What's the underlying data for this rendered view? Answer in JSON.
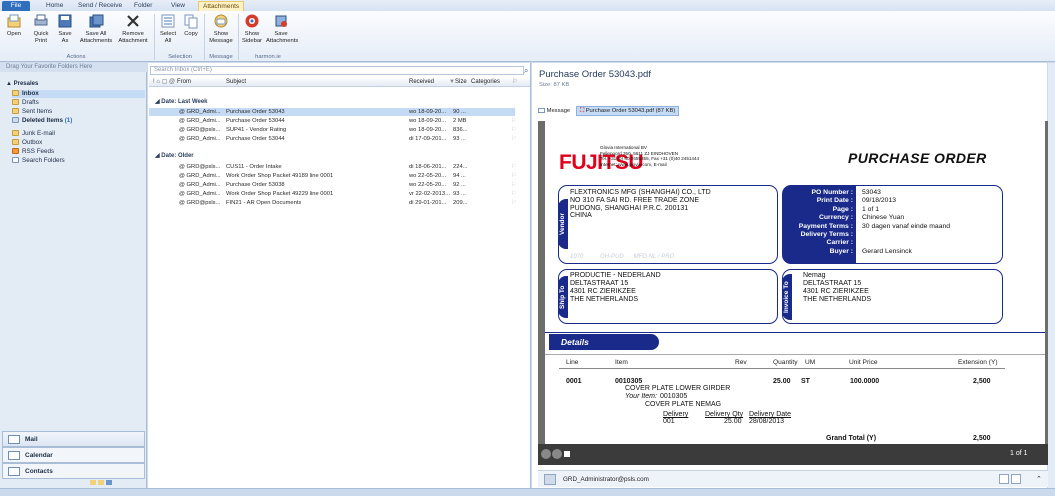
{
  "ribbon": {
    "tabs": [
      "File",
      "Home",
      "Send / Receive",
      "Folder",
      "View",
      "Attachments"
    ],
    "buttons": [
      "Open",
      "Quick Print",
      "Save As",
      "Save All Attachments",
      "Remove Attachment",
      "Select All",
      "Copy",
      "Show Message",
      "Show Sidebar",
      "Save Attachments"
    ],
    "groups": [
      "Actions",
      "Selection",
      "Message",
      "harmon.ie"
    ]
  },
  "nav": {
    "header": "Drag Your Favorite Folders Here",
    "account": "Presales",
    "folders": [
      "Inbox",
      "Drafts",
      "Sent Items",
      "Deleted Items",
      "Junk E-mail",
      "Outbox",
      "RSS Feeds",
      "Search Folders"
    ],
    "deleted_count": "(1)",
    "bottom": [
      "Mail",
      "Calendar",
      "Contacts"
    ]
  },
  "list": {
    "search_placeholder": "Search Inbox (Ctrl+E)",
    "columns": {
      "from": "From",
      "subject": "Subject",
      "received": "Received",
      "size": "Size",
      "categories": "Categories"
    },
    "groups": [
      {
        "label": "Date: Last Week",
        "rows": [
          {
            "from": "@ GRD_Admi...",
            "subject": "Purchase Order 53043",
            "received": "wo 18-09-20...",
            "size": "90 ...",
            "selected": true
          },
          {
            "from": "@ GRD_Admi...",
            "subject": "Purchase Order 53044",
            "received": "wo 18-09-20...",
            "size": "2 MB",
            "selected": false
          },
          {
            "from": "@ GRD@psls...",
            "subject": "SUP41 - Vendor Rating",
            "received": "wo 18-09-20...",
            "size": "836...",
            "selected": false
          },
          {
            "from": "@ GRD_Admi...",
            "subject": "Purchase Order 53044",
            "received": "di 17-09-201...",
            "size": "93 ...",
            "selected": false
          }
        ]
      },
      {
        "label": "Date: Older",
        "rows": [
          {
            "from": "@ GRD@psls...",
            "subject": "CUS11 - Order Intake",
            "received": "di 18-06-201...",
            "size": "224...",
            "selected": false
          },
          {
            "from": "@ GRD_Admi...",
            "subject": "Work Order Shop Packet 49189 line 0001",
            "received": "wo 22-05-20...",
            "size": "94 ...",
            "selected": false
          },
          {
            "from": "@ GRD_Admi...",
            "subject": "Purchase Order 53038",
            "received": "wo 22-05-20...",
            "size": "92 ...",
            "selected": false
          },
          {
            "from": "@ GRD_Admi...",
            "subject": "Work Order Shop Packet 49229 line 0001",
            "received": "vr 22-02-2013...",
            "size": "93 ...",
            "selected": false
          },
          {
            "from": "@ GRD@psls...",
            "subject": "FIN21 - AR Open Documents",
            "received": "di 29-01-201...",
            "size": "209...",
            "selected": false
          }
        ]
      }
    ]
  },
  "reading": {
    "title": "Purchase Order 53043.pdf",
    "size": "Size: 87 KB",
    "message_tab": "Message",
    "attachment_tab": "Purchase Order 53043.pdf (87 KB)",
    "sender": "GRD_Administrator@psls.com",
    "pager": "1 of 1"
  },
  "doc": {
    "logo": "FUJITSU",
    "company": "Glovia International BV\nFellenoord 350, 5611 ZJ EINDHOVEN\nTel. +31 (0) 40 2655355, Fax +31 (0)40 2451444\nInternet: www.glovia.com, E-mail",
    "heading": "PURCHASE ORDER",
    "vendor_label": "Vendor",
    "vendor": "FLEXTRONICS MFG (SHANGHAI) CO., LTD\nNO 310 FA SAI RD. FREE TRADE ZONE\nPUDONG, SHANGHAI P.R.C. 200131\nCHINA",
    "watermark": "1070          GH-PUD      MFG NL / PRO",
    "po_labels": [
      "PO Number :",
      "Print Date :",
      "Page :",
      "Currency :",
      "Payment Terms :",
      "Delivery Terms :",
      "Carrier :",
      "Buyer :"
    ],
    "po_values": [
      "53043",
      "09/18/2013",
      "1 of 1",
      "Chinese Yuan",
      "30 dagen vanaf einde maand",
      "",
      "",
      "Gerard Lensinck"
    ],
    "shipto_label": "Ship To",
    "shipto": "PRODUCTIE - NEDERLAND\nDELTASTRAAT 15\n4301 RC ZIERIKZEE\nTHE NETHERLANDS",
    "invoice_label": "Invoice To",
    "invoice": "Nemag\nDELTASTRAAT 15\n4301 RC ZIERIKZEE\nTHE NETHERLANDS",
    "details": "Details",
    "table_headers": [
      "Line",
      "Item",
      "Rev",
      "Quantity",
      "UM",
      "Unit Price",
      "Extension (Y)"
    ],
    "line": "0001",
    "item": "0010305",
    "item_desc": "COVER PLATE LOWER GIRDER",
    "your_item_label": "Your Item:",
    "your_item": "0010305",
    "your_item_desc": "COVER PLATE NEMAG",
    "qty": "25.00",
    "um": "ST",
    "unit_price": "100.0000",
    "extension": "2,500",
    "delivery_h": "Delivery",
    "delivery_qty_h": "Delivery Qty",
    "delivery_date_h": "Delivery Date",
    "delivery": "001",
    "delivery_qty": "25.00",
    "delivery_date": "28/08/2013",
    "grand_total_label": "Grand Total (Y)",
    "grand_total": "2,500"
  },
  "colors": {
    "accent": "#1a2a8a",
    "fujitsu_red": "#e0001b",
    "selected_row": "#c5dbf5"
  }
}
